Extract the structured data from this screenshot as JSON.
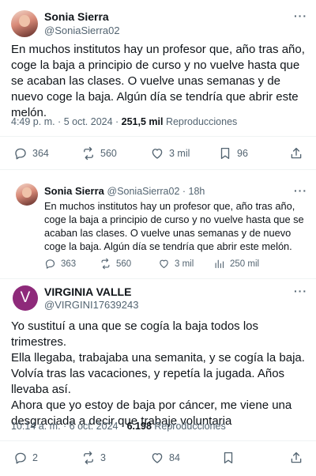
{
  "main_tweet": {
    "author_name": "Sonia Sierra",
    "author_handle": "@SoniaSierra02",
    "text": "En muchos institutos hay un profesor que, año tras año, coge la baja a principio de curso y no vuelve hasta que se acaban las clases. O vuelve unas semanas y de nuevo coge la baja. Algún día se tendría que abrir este melón.",
    "time": "4:49 p. m. · 5 oct. 2024 · ",
    "views_count": "251,5 mil",
    "views_label": " Reproducciones",
    "replies": "364",
    "retweets": "560",
    "likes": "3 mil",
    "bookmarks": "96"
  },
  "quoted_tweet": {
    "author_name": "Sonia Sierra",
    "author_handle": "@SoniaSierra02 · 18h",
    "text": "En muchos institutos hay un profesor que, año tras año, coge la baja a principio de curso y no vuelve hasta que se acaban las clases. O vuelve unas semanas y de nuevo coge la baja. Algún día se tendría que abrir este melón.",
    "replies": "363",
    "retweets": "560",
    "likes": "3 mil",
    "views": "250 mil"
  },
  "reply_tweet": {
    "avatar_letter": "V",
    "author_name": "VIRGINIA VALLE",
    "author_handle": "@VIRGINI17639243",
    "text_lines": [
      "Yo sustituí a una que se cogía la baja todos los trimestres.",
      "Ella llegaba, trabajaba una semanita, y se cogía la baja.",
      "Volvía tras las vacaciones, y repetía la jugada. Años llevaba así.",
      "Ahora que yo estoy de baja por cáncer, me viene una desgraciada a decir que trabaje voluntaria"
    ],
    "time": "10:14 a. m. · 6 oct. 2024 · ",
    "views_count": "6.198",
    "views_label": " Reproducciones",
    "replies": "2",
    "retweets": "3",
    "likes": "84"
  },
  "icons": {
    "more": "more-icon",
    "reply": "reply-icon",
    "retweet": "retweet-icon",
    "like": "heart-icon",
    "bookmark": "bookmark-icon",
    "share": "share-icon",
    "views": "views-icon"
  },
  "colors": {
    "text": "#0f1419",
    "secondary": "#536471",
    "border": "#cfd9de",
    "divider": "#eff3f4",
    "avatar_virginia": "#8e2a7a"
  }
}
